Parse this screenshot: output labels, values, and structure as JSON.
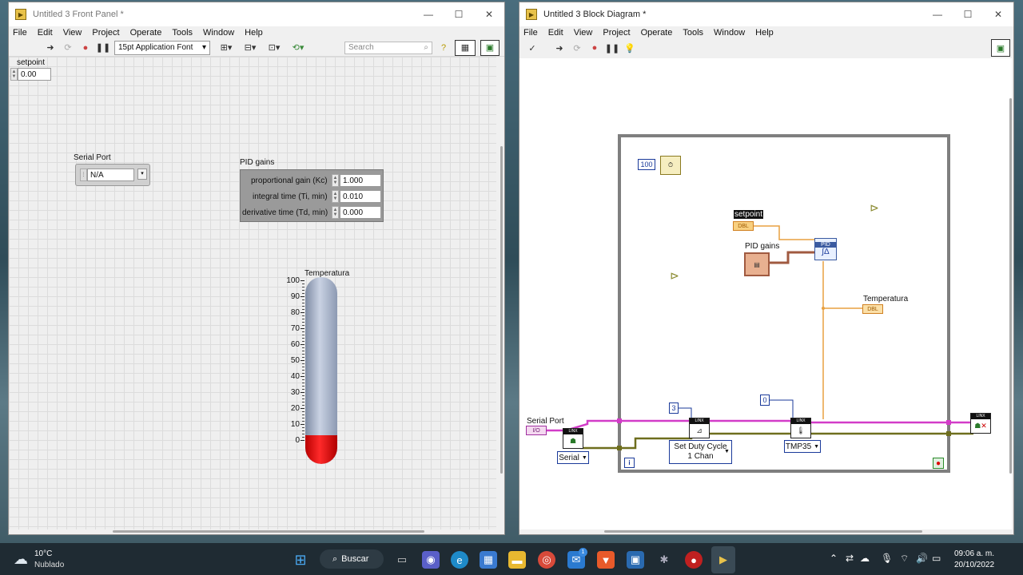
{
  "front_panel": {
    "title": "Untitled 3 Front Panel *",
    "menu": [
      "File",
      "Edit",
      "View",
      "Project",
      "Operate",
      "Tools",
      "Window",
      "Help"
    ],
    "font_selector": "15pt Application Font",
    "search_placeholder": "Search",
    "setpoint": {
      "label": "setpoint",
      "value": "0.00"
    },
    "serial_port": {
      "label": "Serial Port",
      "value": "N/A"
    },
    "pid_gains": {
      "label": "PID gains",
      "rows": [
        {
          "label": "proportional gain (Kc)",
          "value": "1.000"
        },
        {
          "label": "integral time (Ti, min)",
          "value": "0.010"
        },
        {
          "label": "derivative time (Td, min)",
          "value": "0.000"
        }
      ]
    },
    "thermometer": {
      "label": "Temperatura",
      "scale": [
        "100",
        "90",
        "80",
        "70",
        "60",
        "50",
        "40",
        "30",
        "20",
        "10",
        "0"
      ],
      "level": 0
    }
  },
  "block_diagram": {
    "title": "Untitled 3 Block Diagram *",
    "menu": [
      "File",
      "Edit",
      "View",
      "Project",
      "Operate",
      "Tools",
      "Window",
      "Help"
    ],
    "wait_constant": "100",
    "setpoint_label": "setpoint",
    "setpoint_type": "DBL",
    "pid_gains_label": "PID gains",
    "pid_node": "PID",
    "temperatura_label": "Temperatura",
    "temperatura_type": "DBL",
    "serial_port_label": "Serial Port",
    "serial_port_type": "I/O",
    "serial_ring": "Serial",
    "duty_const": "3",
    "duty_ring": "Set Duty Cycle\n1 Chan",
    "duty_ring_l1": "Set Duty Cycle",
    "duty_ring_l2": "1 Chan",
    "tmp_const": "0",
    "tmp_ring": "TMP35",
    "linx_label": "LINX",
    "info_icon": "i"
  },
  "taskbar": {
    "weather_temp": "10°C",
    "weather_desc": "Nublado",
    "search_label": "Buscar",
    "time": "09:06 a. m.",
    "date": "20/10/2022",
    "badge": "1"
  },
  "colors": {
    "accent_wire_pink": "#d23cc8",
    "wire_orange": "#e8a040",
    "wire_dark": "#6e6e1e",
    "loop_border": "#7f7f7f"
  }
}
